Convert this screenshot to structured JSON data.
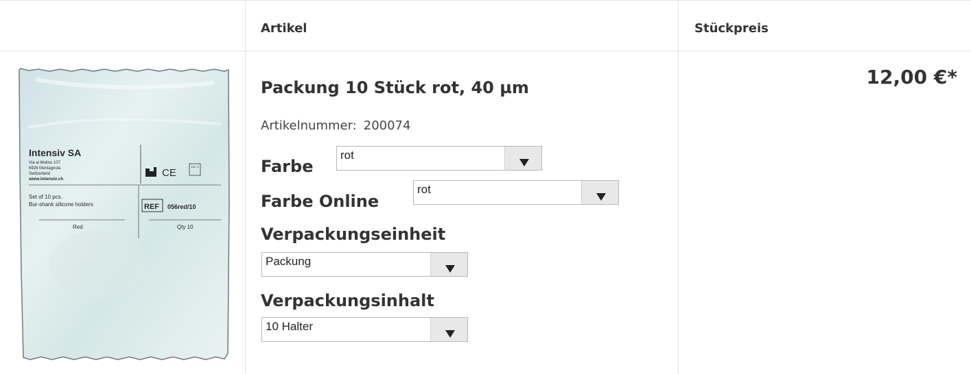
{
  "table": {
    "headers": {
      "image": "",
      "article": "Artikel",
      "price": "Stückpreis"
    }
  },
  "product": {
    "title": "Packung 10 Stück rot, 40 µm",
    "article_number_label": "Artikelnummer:",
    "article_number": "200074",
    "price": "12,00 €*",
    "image_label": {
      "company": "Intensiv SA",
      "address_1": "Via al Molino 107",
      "address_2": "6926 Montagnola",
      "country": "Switzerland",
      "web": "www.intensiv.ch",
      "set_line_1": "Set of 10 pcs.",
      "set_line_2": "Bur-shank silicone holders",
      "ref_box": "REF",
      "ref_code": "056red/10",
      "color": "Red",
      "qty": "Qty 10",
      "ce": "CE",
      "temp": "134 °C"
    }
  },
  "options": {
    "farbe": {
      "label": "Farbe",
      "value": "rot"
    },
    "farbe_online": {
      "label": "Farbe Online",
      "value": "rot"
    },
    "verpackungseinheit": {
      "label": "Verpackungseinheit",
      "value": "Packung"
    },
    "verpackungsinhalt": {
      "label": "Verpackungsinhalt",
      "value": "10 Halter"
    }
  }
}
